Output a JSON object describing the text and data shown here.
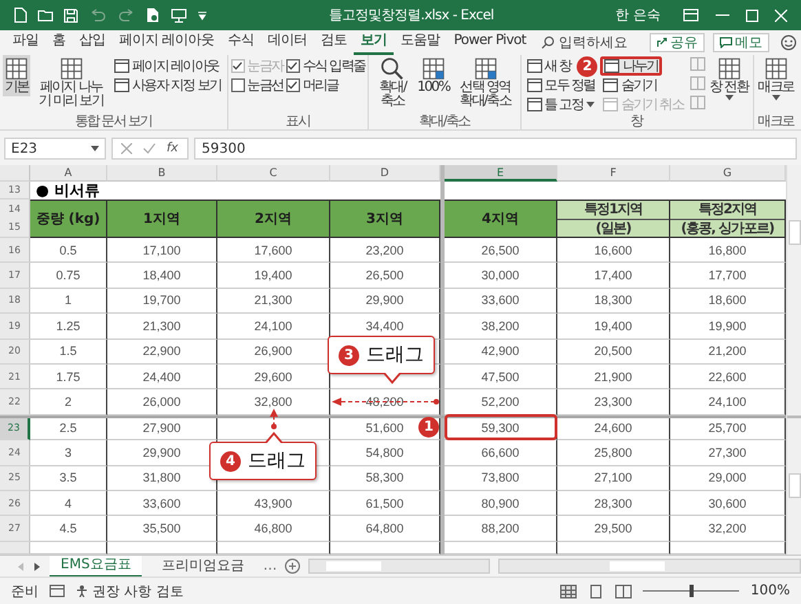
{
  "title_bar": {
    "title": "틀고정및창정렬.xlsx - Excel",
    "user": "한 은숙"
  },
  "menu_tabs": [
    {
      "label": "파일",
      "selected": false
    },
    {
      "label": "홈",
      "selected": false
    },
    {
      "label": "삽입",
      "selected": false
    },
    {
      "label": "페이지 레이아웃",
      "selected": false
    },
    {
      "label": "수식",
      "selected": false
    },
    {
      "label": "데이터",
      "selected": false
    },
    {
      "label": "검토",
      "selected": false
    },
    {
      "label": "보기",
      "selected": true
    },
    {
      "label": "도움말",
      "selected": false
    },
    {
      "label": "Power Pivot",
      "selected": false
    }
  ],
  "search": {
    "placeholder": "입력하세요"
  },
  "share_button": "공유",
  "comment_button": "메모",
  "ribbon": {
    "groups": [
      {
        "label": "통합 문서 보기",
        "items": [
          {
            "kind": "large",
            "label": "기본",
            "selected": true
          },
          {
            "kind": "large",
            "label": "페이지 나누기 미리 보기",
            "selected": false
          },
          {
            "kind": "small",
            "label": "페이지 레이아웃",
            "disabled": false
          },
          {
            "kind": "small",
            "label": "사용자 지정 보기",
            "disabled": false
          }
        ]
      },
      {
        "label": "표시",
        "items": [
          {
            "kind": "check",
            "label": "눈금자",
            "checked": true,
            "disabled": true
          },
          {
            "kind": "check",
            "label": "눈금선",
            "checked": false,
            "disabled": false
          },
          {
            "kind": "check",
            "label": "수식 입력줄",
            "checked": true,
            "disabled": false
          },
          {
            "kind": "check",
            "label": "머리글",
            "checked": true,
            "disabled": false
          }
        ]
      },
      {
        "label": "확대/축소",
        "items": [
          {
            "kind": "large",
            "label": "확대/축소",
            "selected": false
          },
          {
            "kind": "large",
            "label": "100%",
            "selected": false
          },
          {
            "kind": "large",
            "label": "선택 영역 확대/축소",
            "selected": false
          }
        ]
      },
      {
        "label": "창",
        "items": [
          {
            "kind": "small",
            "label": "새 창",
            "disabled": false
          },
          {
            "kind": "small",
            "label": "모두 정렬",
            "disabled": false
          },
          {
            "kind": "small",
            "label": "틀 고정",
            "disabled": false,
            "dropdown": true
          },
          {
            "kind": "small",
            "label": "나누기",
            "disabled": false,
            "marker": "2"
          },
          {
            "kind": "small",
            "label": "숨기기",
            "disabled": false
          },
          {
            "kind": "small",
            "label": "숨기기 취소",
            "disabled": true
          },
          {
            "kind": "icon",
            "disabled": true
          },
          {
            "kind": "icon",
            "disabled": true
          },
          {
            "kind": "icon",
            "disabled": true
          },
          {
            "kind": "large",
            "label": "창 전환",
            "selected": false,
            "dropdown": true
          }
        ]
      },
      {
        "label": "매크로",
        "items": [
          {
            "kind": "large",
            "label": "매크로",
            "selected": false,
            "dropdown": true
          }
        ]
      }
    ]
  },
  "formula_bar": {
    "name_box": "E23",
    "function_label": "fx",
    "value": "59300"
  },
  "sheet": {
    "columns": [
      {
        "label": "A",
        "selected": false
      },
      {
        "label": "B",
        "selected": false
      },
      {
        "label": "C",
        "selected": false
      },
      {
        "label": "D",
        "selected": false
      },
      {
        "label": "E",
        "selected": true
      },
      {
        "label": "F",
        "selected": false
      },
      {
        "label": "G",
        "selected": false
      }
    ],
    "title_row": {
      "num": "13",
      "text": "● 비서류"
    },
    "header_rows": {
      "nums": [
        "14",
        "15"
      ],
      "cells": [
        {
          "kind": "dark",
          "lines": [
            "중량 (kg)"
          ]
        },
        {
          "kind": "dark",
          "lines": [
            "1지역"
          ]
        },
        {
          "kind": "dark",
          "lines": [
            "2지역"
          ]
        },
        {
          "kind": "dark",
          "lines": [
            "3지역"
          ]
        },
        {
          "kind": "dark",
          "lines": [
            "4지역"
          ]
        },
        {
          "kind": "light",
          "lines": [
            "특정1지역",
            "(일본)"
          ]
        },
        {
          "kind": "light",
          "lines": [
            "특정2지역",
            "(홍콩, 싱가포르)"
          ]
        }
      ]
    },
    "rows": [
      {
        "num": "16",
        "selected": false,
        "cells": [
          "0.5",
          "17,100",
          "17,600",
          "23,200",
          "26,500",
          "16,600",
          "16,800"
        ]
      },
      {
        "num": "17",
        "selected": false,
        "cells": [
          "0.75",
          "18,400",
          "19,400",
          "26,500",
          "30,000",
          "17,400",
          "17,700"
        ]
      },
      {
        "num": "18",
        "selected": false,
        "cells": [
          "1",
          "19,700",
          "21,300",
          "29,900",
          "33,600",
          "18,300",
          "18,600"
        ]
      },
      {
        "num": "19",
        "selected": false,
        "cells": [
          "1.25",
          "21,300",
          "24,100",
          "34,400",
          "38,200",
          "19,400",
          "19,900"
        ]
      },
      {
        "num": "20",
        "selected": false,
        "cells": [
          "1.5",
          "22,900",
          "26,900",
          null,
          "42,900",
          "20,500",
          "21,200"
        ]
      },
      {
        "num": "21",
        "selected": false,
        "cells": [
          "1.75",
          "24,400",
          "29,600",
          null,
          "47,500",
          "21,900",
          "22,600"
        ]
      },
      {
        "num": "22",
        "selected": false,
        "cells": [
          "2",
          "26,000",
          "32,800",
          "48,200",
          "52,200",
          "23,300",
          "24,100"
        ]
      },
      {
        "num": "23",
        "selected": true,
        "cells": [
          "2.5",
          "27,900",
          null,
          "51,600",
          "59,300",
          "24,600",
          "25,700"
        ]
      },
      {
        "num": "24",
        "selected": false,
        "cells": [
          "3",
          "29,900",
          null,
          "54,800",
          "66,600",
          "25,800",
          "27,300"
        ]
      },
      {
        "num": "25",
        "selected": false,
        "cells": [
          "3.5",
          "31,800",
          null,
          "58,300",
          "73,800",
          "27,100",
          "29,000"
        ]
      },
      {
        "num": "26",
        "selected": false,
        "cells": [
          "4",
          "33,600",
          "43,900",
          "61,500",
          "80,900",
          "28,300",
          "30,600"
        ]
      },
      {
        "num": "27",
        "selected": false,
        "cells": [
          "4.5",
          "35,500",
          "46,800",
          "64,800",
          "88,200",
          "29,500",
          "32,200"
        ]
      }
    ]
  },
  "callouts": [
    {
      "kind": "badge",
      "number": "1"
    },
    {
      "kind": "bubble",
      "number": "3",
      "text": "드래그"
    },
    {
      "kind": "bubble",
      "number": "4",
      "text": "드래그"
    }
  ],
  "sheet_tabs": {
    "tabs": [
      {
        "label": "EMS요금표",
        "selected": true
      },
      {
        "label": "프리미엄요금",
        "selected": false
      }
    ],
    "more": "…"
  },
  "status_bar": {
    "mode": "준비",
    "accessibility": "권장 사항 검토",
    "zoom": "100%",
    "zoom_slider": {
      "level": 0.5
    }
  }
}
